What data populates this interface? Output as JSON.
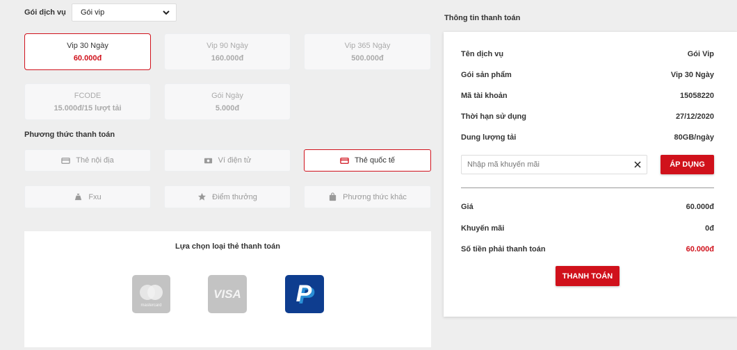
{
  "service": {
    "label": "Gói dịch vụ",
    "selected": "Gói vip"
  },
  "packages": [
    {
      "name": "Vip 30 Ngày",
      "price": "60.000đ",
      "active": true
    },
    {
      "name": "Vip 90 Ngày",
      "price": "160.000đ",
      "active": false
    },
    {
      "name": "Vip 365 Ngày",
      "price": "500.000đ",
      "active": false
    },
    {
      "name": "FCODE",
      "price": "15.000đ/15 lượt tải",
      "active": false
    },
    {
      "name": "Gói Ngày",
      "price": "5.000đ",
      "active": false
    }
  ],
  "payment_methods": {
    "label": "Phương thức thanh toán",
    "items": [
      {
        "label": "Thẻ nội địa",
        "icon": "card-icon",
        "active": false
      },
      {
        "label": "Ví điện tử",
        "icon": "wallet-icon",
        "active": false
      },
      {
        "label": "Thẻ quốc tế",
        "icon": "card-icon",
        "active": true
      },
      {
        "label": "Fxu",
        "icon": "money-bag-icon",
        "active": false
      },
      {
        "label": "Điểm thưởng",
        "icon": "star-icon",
        "active": false
      },
      {
        "label": "Phương thức khác",
        "icon": "bag-icon",
        "active": false
      }
    ]
  },
  "card_type": {
    "title": "Lựa chọn loại thẻ thanh toán",
    "cards": [
      {
        "name": "mastercard",
        "label": "mastercard"
      },
      {
        "name": "visa",
        "label": "VISA"
      },
      {
        "name": "paypal",
        "label": "P"
      }
    ]
  },
  "summary": {
    "title": "Thông tin thanh toán",
    "rows": [
      {
        "label": "Tên dịch vụ",
        "value": "Gói Vip"
      },
      {
        "label": "Gói sản phẩm",
        "value": "Vip 30 Ngày"
      },
      {
        "label": "Mã tài khoản",
        "value": "15058220"
      },
      {
        "label": "Thời hạn sử dụng",
        "value": "27/12/2020"
      },
      {
        "label": "Dung lượng tải",
        "value": "80GB/ngày"
      }
    ],
    "promo_placeholder": "Nhập mã khuyến mãi",
    "apply_label": "ÁP DỤNG",
    "totals": [
      {
        "label": "Giá",
        "value": "60.000đ"
      },
      {
        "label": "Khuyến mãi",
        "value": "0đ"
      },
      {
        "label": "Số tiền phải thanh toán",
        "value": "60.000đ"
      }
    ],
    "pay_label": "THANH TOÁN"
  },
  "colors": {
    "accent": "#d0111b",
    "muted": "#aaaaaa",
    "background": "#eeeeee"
  }
}
